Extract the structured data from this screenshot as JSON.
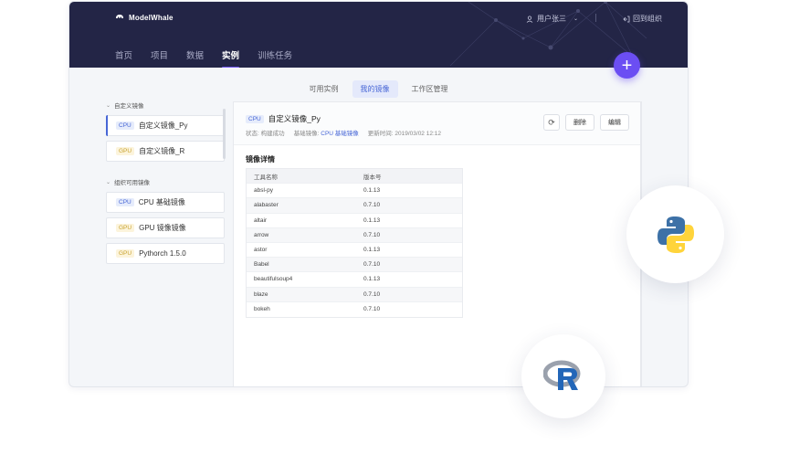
{
  "header": {
    "brand": "ModelWhale",
    "user_label": "用户张三",
    "back_label": "回到组织",
    "nav": [
      {
        "label": "首页"
      },
      {
        "label": "项目"
      },
      {
        "label": "数据"
      },
      {
        "label": "实例"
      },
      {
        "label": "训练任务"
      }
    ],
    "active_nav": "实例"
  },
  "subtabs": [
    {
      "label": "可用实例"
    },
    {
      "label": "我的镜像"
    },
    {
      "label": "工作区管理"
    }
  ],
  "active_subtab": "我的镜像",
  "sidebar": {
    "custom_group": {
      "title": "自定义镜像",
      "items": [
        {
          "badge": "CPU",
          "label": "自定义镜像_Py"
        },
        {
          "badge": "GPU",
          "label": "自定义镜像_R"
        }
      ]
    },
    "org_group": {
      "title": "组织可用镜像",
      "items": [
        {
          "badge": "CPU",
          "label": "CPU 基础镜像"
        },
        {
          "badge": "GPU",
          "label": "GPU 镜像镜像"
        },
        {
          "badge": "GPU",
          "label": "Pythorch 1.5.0"
        }
      ]
    }
  },
  "detail": {
    "badge": "CPU",
    "title": "自定义镜像_Py",
    "status_label": "状态: 构建成功",
    "base_prefix": "基础镜像:",
    "base_link": "CPU 基础镜像",
    "updated": "更新时间: 2019/03/02 12:12",
    "delete_label": "删除",
    "edit_label": "编辑",
    "section_title": "镜像详情",
    "table": {
      "headers": [
        "工具名称",
        "版本号"
      ],
      "rows": [
        [
          "absl-py",
          "0.1.13"
        ],
        [
          "alabaster",
          "0.7.10"
        ],
        [
          "altair",
          "0.1.13"
        ],
        [
          "arrow",
          "0.7.10"
        ],
        [
          "astor",
          "0.1.13"
        ],
        [
          "Babel",
          "0.7.10"
        ],
        [
          "beautifulsoup4",
          "0.1.13"
        ],
        [
          "blaze",
          "0.7.10"
        ],
        [
          "bokeh",
          "0.7.10"
        ]
      ]
    }
  },
  "colors": {
    "topbar": "#232546",
    "accent": "#6b4ef3",
    "link": "#4766d6",
    "python_blue": "#3d71a7",
    "python_yellow": "#ffd43b",
    "r_blue": "#2266b8"
  },
  "icons": {
    "logo": "whale-logo-icon",
    "user": "user-icon",
    "back": "exit-icon",
    "refresh": "refresh-icon",
    "add": "plus-icon",
    "python": "python-logo",
    "r": "r-logo"
  }
}
